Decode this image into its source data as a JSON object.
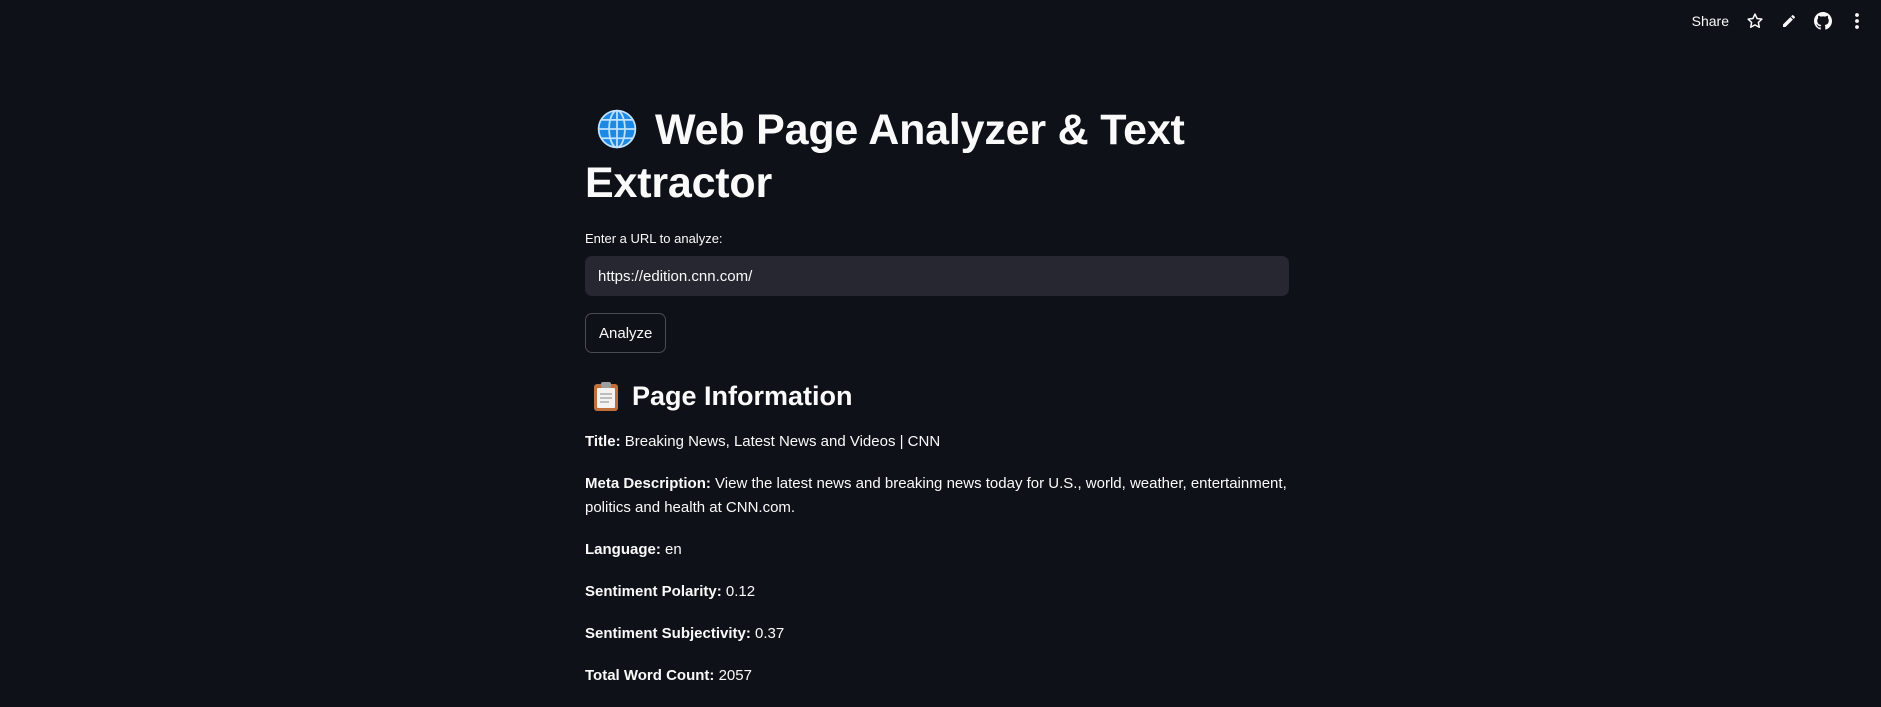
{
  "toolbar": {
    "share_label": "Share",
    "icons": [
      "star-icon",
      "pencil-icon",
      "github-icon",
      "kebab-menu-icon"
    ]
  },
  "header": {
    "title_icon": "globe-icon",
    "title": "Web Page Analyzer & Text Extractor"
  },
  "form": {
    "url_label": "Enter a URL to analyze:",
    "url_value": "https://edition.cnn.com/",
    "analyze_label": "Analyze"
  },
  "page_info": {
    "heading_icon": "clipboard-icon",
    "heading": "Page Information",
    "title_label": "Title:",
    "title_value": "Breaking News, Latest News and Videos | CNN",
    "meta_label": "Meta Description:",
    "meta_value": "View the latest news and breaking news today for U.S., world, weather, entertainment, politics and health at CNN.com.",
    "language_label": "Language:",
    "language_value": "en",
    "polarity_label": "Sentiment Polarity:",
    "polarity_value": "0.12",
    "subjectivity_label": "Sentiment Subjectivity:",
    "subjectivity_value": "0.37",
    "word_count_label": "Total Word Count:",
    "word_count_value": "2057"
  },
  "colors": {
    "background": "#0e1117",
    "input_background": "#262730",
    "text": "#fafafa"
  }
}
